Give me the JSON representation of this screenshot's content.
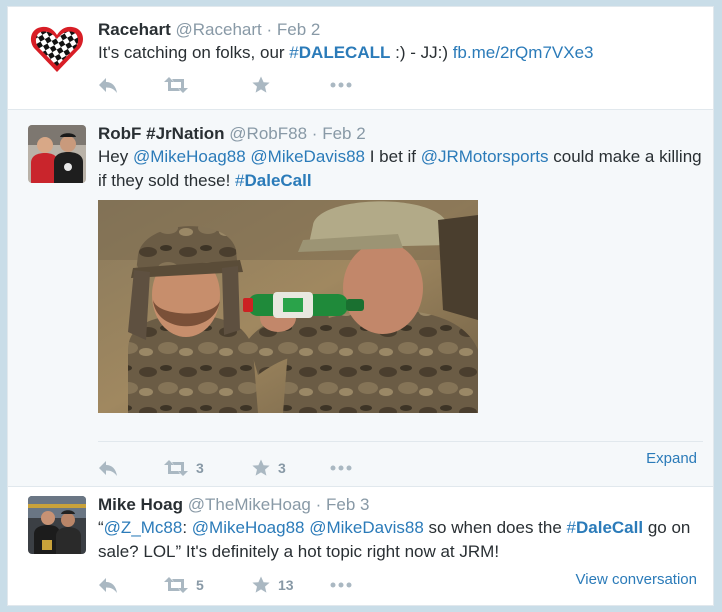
{
  "tweets": [
    {
      "fullname": "Racehart",
      "username": "@Racehart",
      "separator": "·",
      "time": "Feb 2",
      "text": {
        "pre": "It's catching on folks, our ",
        "hashtag_symbol": "#",
        "hashtag": "DALECALL",
        "post": " :) - JJ:) ",
        "link": "fb.me/2rQm7VXe3"
      }
    },
    {
      "fullname": "RobF #JrNation",
      "username": "@RobF88",
      "separator": "·",
      "time": "Feb 2",
      "text": {
        "pre": "Hey ",
        "mention1": "@MikeHoag88",
        "space1": " ",
        "mention2": "@MikeDavis88",
        "mid": " I bet if ",
        "mention3": "@JRMotorsports",
        "post": " could make a killing if they sold these! ",
        "hashtag_symbol": "#",
        "hashtag": "DaleCall"
      },
      "retweet_count": "3",
      "favorite_count": "3",
      "expand_label": "Expand"
    },
    {
      "fullname": "Mike Hoag",
      "username": "@TheMikeHoag",
      "separator": "·",
      "time": "Feb 3",
      "text": {
        "quote_open": "“",
        "mention1": "@Z_Mc88",
        "colon": ": ",
        "mention2": "@MikeHoag88",
        "space1": " ",
        "mention3": "@MikeDavis88",
        "mid": " so when does the ",
        "hashtag_symbol": "#",
        "hashtag": "DaleCall",
        "post": " go on sale? LOL”  It's definitely a hot topic right now at JRM!"
      },
      "retweet_count": "5",
      "favorite_count": "13",
      "view_conversation_label": "View conversation"
    }
  ],
  "icons": {
    "reply": "reply-icon",
    "retweet": "retweet-icon",
    "favorite": "star-icon",
    "more": "more-icon"
  },
  "colors": {
    "link": "#2b7bb9",
    "muted": "#8899a6",
    "action_icon": "#aab8c2",
    "background": "#c9dde8",
    "expanded_tweet_bg": "#f5f8fa"
  }
}
